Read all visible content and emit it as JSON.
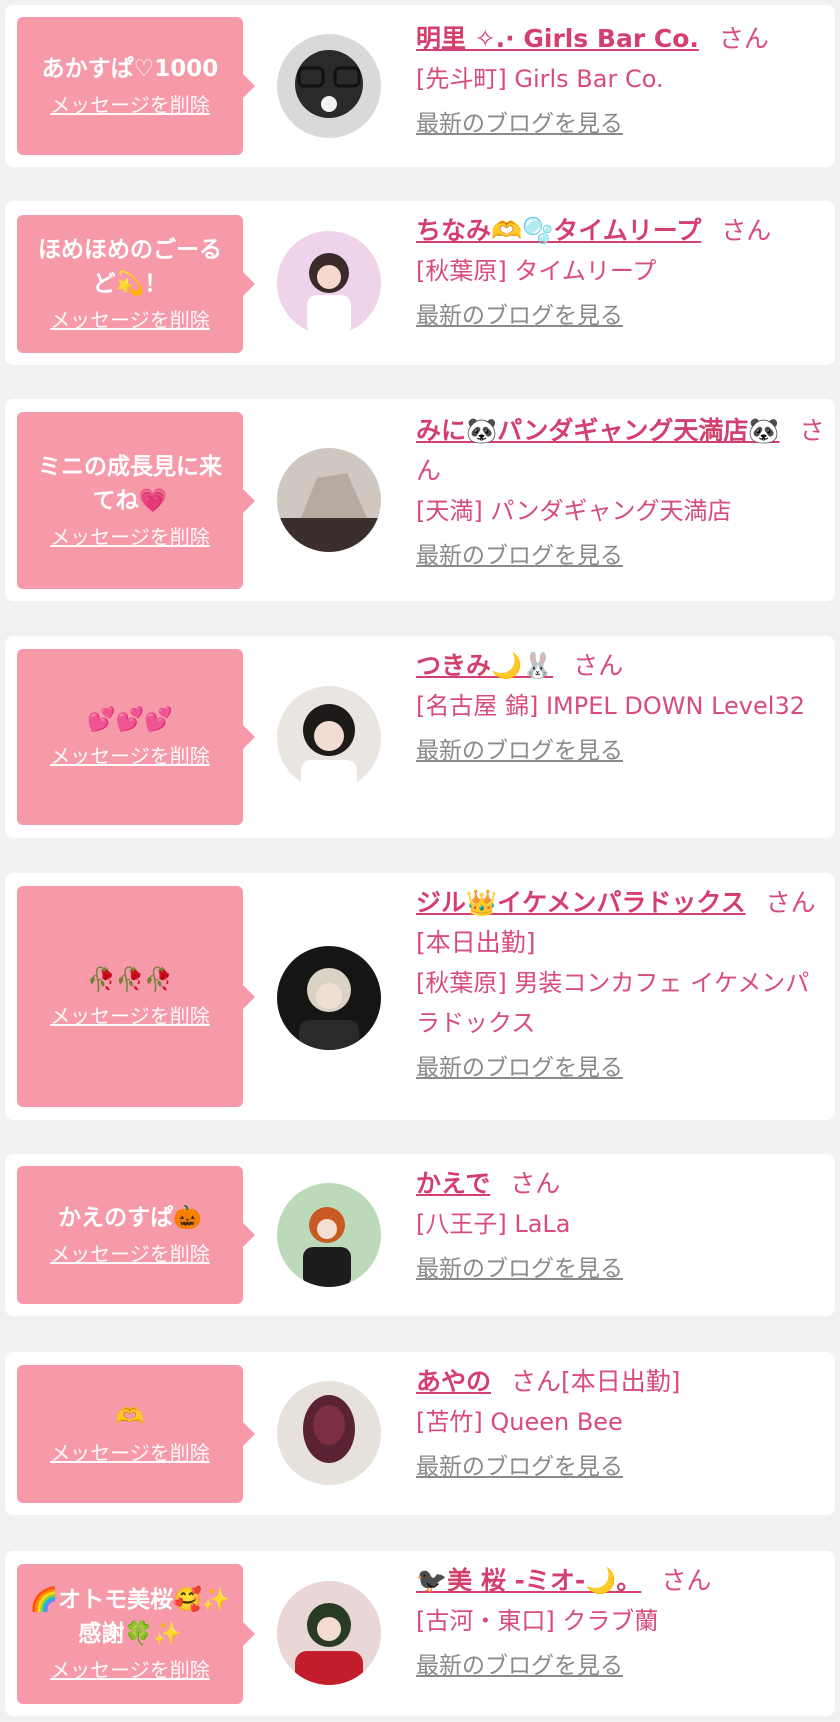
{
  "delete_label": "メッセージを削除",
  "san_label": "さん",
  "blog_label": "最新のブログを見る",
  "colors": {
    "bubble": "#f69aa9",
    "accent": "#d4406e",
    "text_pink": "#d84c78",
    "link_gray": "#8a8a8a"
  },
  "cards": [
    {
      "message": "あかすぱ♡1000",
      "name": "明里 ✧.· Girls Bar Co.",
      "suffix": "",
      "shop": "[先斗町] Girls Bar Co."
    },
    {
      "message": "ほめほめのごーるど💫！",
      "name": "ちなみ🫶🫧タイムリープ",
      "suffix": "",
      "shop": "[秋葉原] タイムリープ"
    },
    {
      "message": "ミニの成長見に来てね💗",
      "name": "みに🐼パンダギャング天満店🐼",
      "suffix": "",
      "shop": "[天満] パンダギャング天満店"
    },
    {
      "message": "💕💕💕",
      "name": "つきみ🌙🐰",
      "suffix": "",
      "shop": "[名古屋 錦] IMPEL DOWN Level32"
    },
    {
      "message": "🥀🥀🥀",
      "name": "ジル👑イケメンパラドックス",
      "suffix": "[本日出勤]",
      "shop": "[秋葉原] 男装コンカフェ イケメンパラドックス"
    },
    {
      "message": "かえのすぱ🎃",
      "name": "かえで",
      "suffix": "",
      "shop": "[八王子] LaLa"
    },
    {
      "message": "🫶",
      "name": "あやの",
      "suffix": "[本日出勤]",
      "shop": "[苫竹] Queen Bee"
    },
    {
      "message": "🌈オトモ美桜🥰✨感謝🍀✨",
      "name": "🐦‍⬛美 桜 -ミオ-🌙。",
      "suffix": "",
      "shop": "[古河・東口] クラブ蘭"
    }
  ]
}
